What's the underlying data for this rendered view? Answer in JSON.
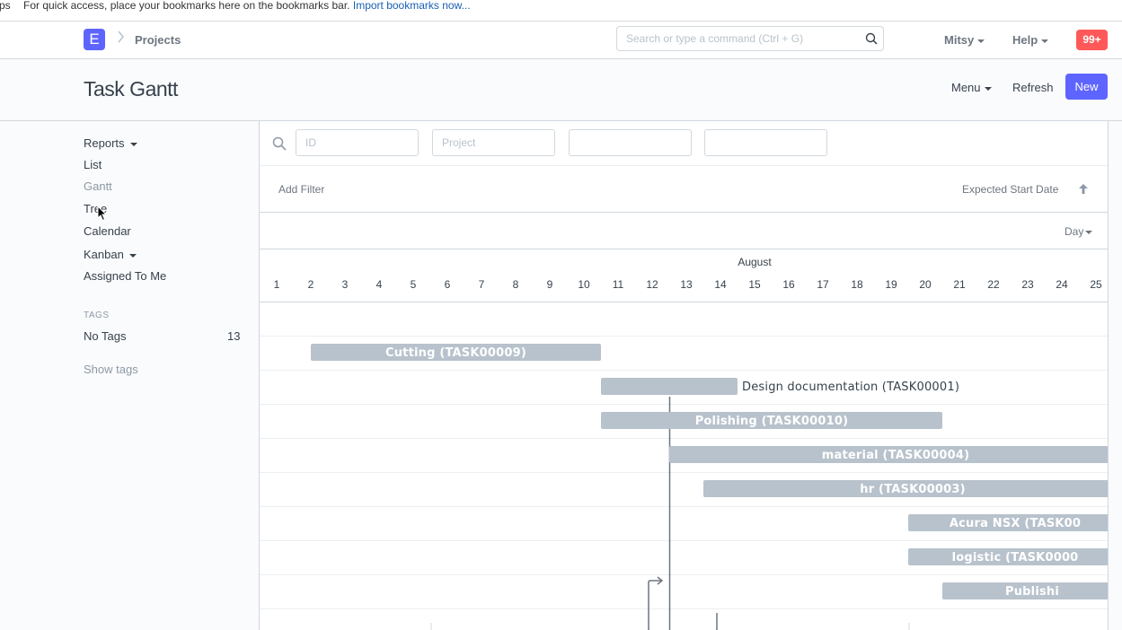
{
  "bookmarks_bar": {
    "fragment": "ps",
    "message": "For quick access, place your bookmarks here on the bookmarks bar.",
    "import_link": "Import bookmarks now..."
  },
  "navbar": {
    "logo_letter": "E",
    "breadcrumb": "Projects",
    "search_placeholder": "Search or type a command (Ctrl + G)",
    "user_menu": "Mitsy",
    "help_menu": "Help",
    "notifications": "99+"
  },
  "page": {
    "title": "Task Gantt",
    "menu_label": "Menu",
    "refresh_label": "Refresh",
    "new_label": "New"
  },
  "sidebar": {
    "items": [
      {
        "label": "Reports",
        "dropdown": true
      },
      {
        "label": "List"
      },
      {
        "label": "Gantt",
        "active": true
      },
      {
        "label": "Tree"
      },
      {
        "label": "Calendar"
      },
      {
        "label": "Kanban",
        "dropdown": true
      },
      {
        "label": "Assigned To Me"
      }
    ],
    "tags_heading": "TAGS",
    "no_tags_label": "No Tags",
    "no_tags_count": "13",
    "show_tags": "Show tags"
  },
  "filters": {
    "id_placeholder": "ID",
    "project_placeholder": "Project",
    "field3_placeholder": "",
    "field4_placeholder": "",
    "add_filter": "Add Filter",
    "sort_label": "Expected Start Date"
  },
  "gantt": {
    "view_mode": "Day",
    "month": "August",
    "days": [
      "1",
      "2",
      "3",
      "4",
      "5",
      "6",
      "7",
      "8",
      "9",
      "10",
      "11",
      "12",
      "13",
      "14",
      "15",
      "16",
      "17",
      "18",
      "19",
      "20",
      "21",
      "22",
      "23",
      "24",
      "25"
    ],
    "tasks": [
      {
        "label": "Cutting (TASK00009)",
        "start": 2,
        "end": 10.5
      },
      {
        "label": "Design documentation (TASK00001)",
        "start": 10.5,
        "end": 14.5,
        "label_outside": true
      },
      {
        "label": "Polishing (TASK00010)",
        "start": 10.5,
        "end": 20.5
      },
      {
        "label": "material (TASK00004)",
        "start": 12.5,
        "end": 26
      },
      {
        "label": "hr (TASK00003)",
        "start": 13.5,
        "end": 26
      },
      {
        "label": "Acura NSX (TASK00",
        "start": 19.5,
        "end": 26
      },
      {
        "label": "logistic (TASK0000",
        "start": 19.5,
        "end": 26
      },
      {
        "label": "Publishi",
        "start": 20.5,
        "end": 26
      }
    ],
    "today_day": 12.5,
    "colors": {
      "bar": "#b8c2cc",
      "bar_text": "#ffffff",
      "outside_text": "#36414c",
      "grid": "#ebeff2",
      "today_line": "#6c7680"
    }
  }
}
